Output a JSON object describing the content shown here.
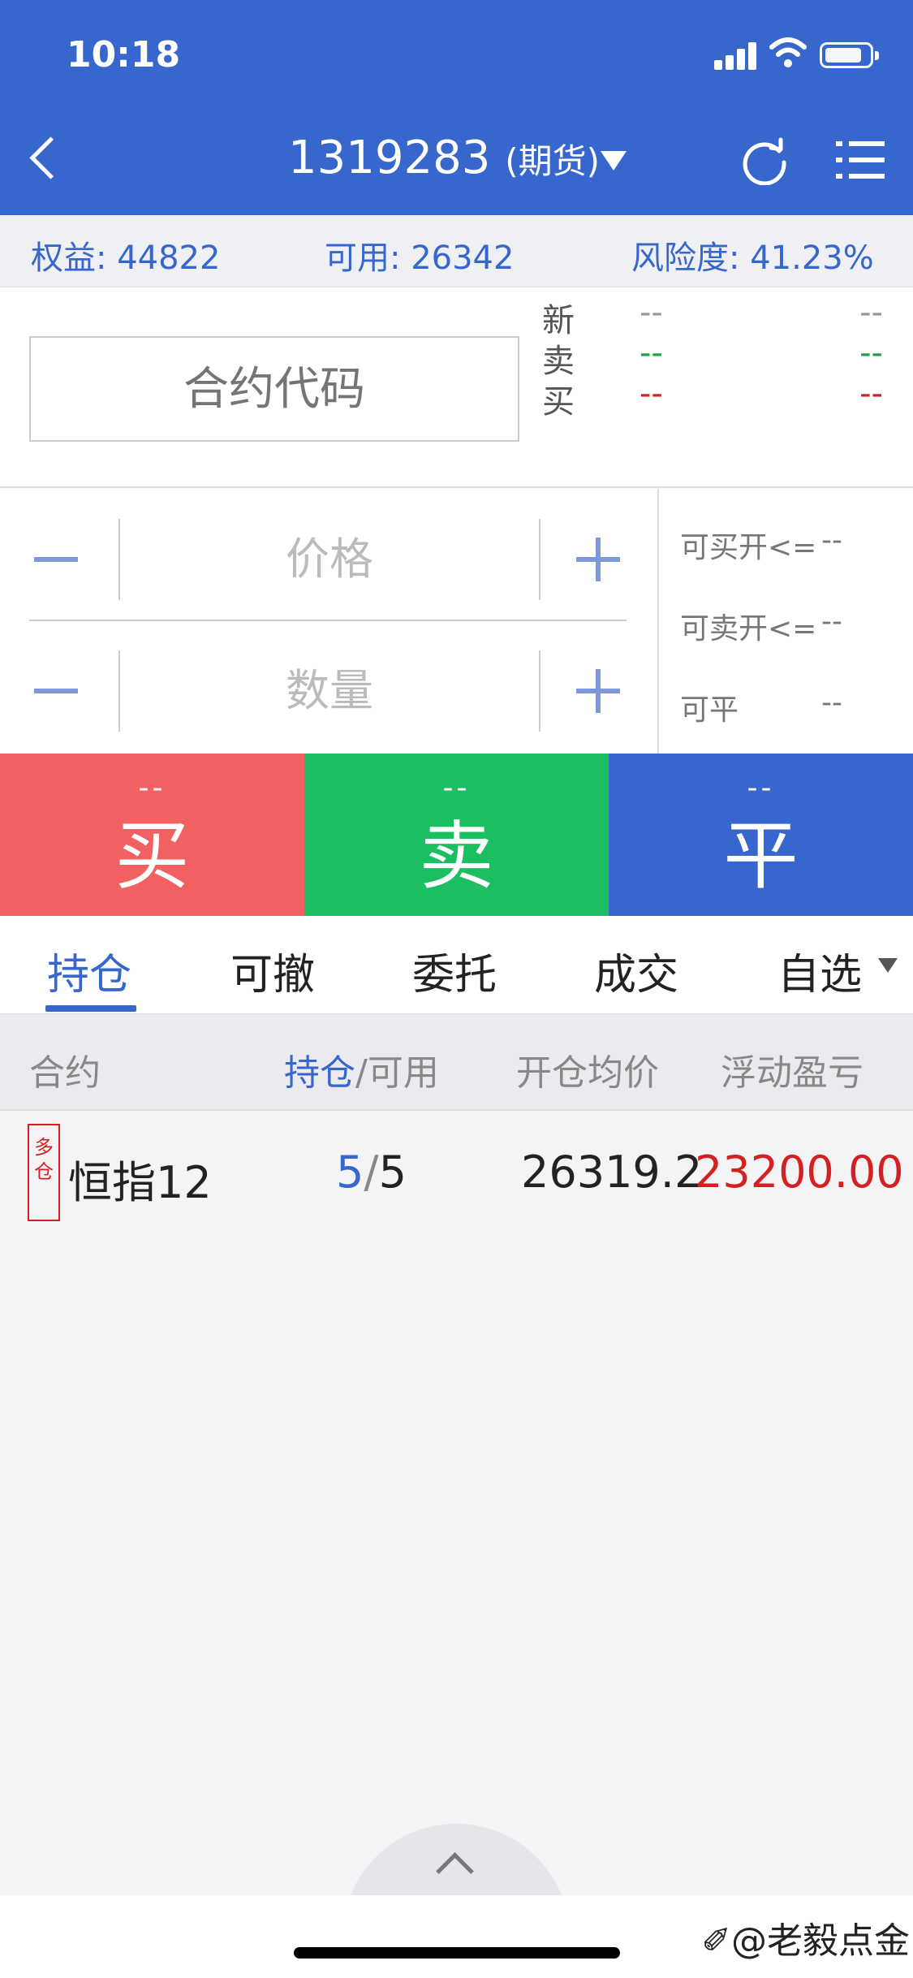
{
  "status_bar": {
    "time": "10:18"
  },
  "header": {
    "account": "1319283",
    "account_type": "(期货)",
    "icons": [
      "back-arrow-icon",
      "chevron-down-icon",
      "refresh-icon",
      "menu-list-icon"
    ]
  },
  "summary": {
    "equity_label": "权益:",
    "equity_value": "44822",
    "available_label": "可用:",
    "available_value": "26342",
    "risk_label": "风险度:",
    "risk_value": "41.23%"
  },
  "quote": {
    "contract_placeholder": "合约代码",
    "rows": [
      {
        "label": "新",
        "v1": "--",
        "v2": "--",
        "color": "#999999"
      },
      {
        "label": "卖",
        "v1": "--",
        "v2": "--",
        "color": "#1aa34a"
      },
      {
        "label": "买",
        "v1": "--",
        "v2": "--",
        "color": "#d42020"
      }
    ]
  },
  "order": {
    "price_placeholder": "价格",
    "quantity_placeholder": "数量",
    "can_buy_open_label": "可买开<=",
    "can_buy_open_value": "--",
    "can_sell_open_label": "可卖开<=",
    "can_sell_open_value": "--",
    "can_close_label": "可平",
    "can_close_value": "--"
  },
  "trade_buttons": [
    {
      "price": "--",
      "action": "买",
      "color": "#f26161"
    },
    {
      "price": "--",
      "action": "卖",
      "color": "#1bbf62"
    },
    {
      "price": "--",
      "action": "平",
      "color": "#3766cc"
    }
  ],
  "tabs": [
    {
      "label": "持仓",
      "active": true
    },
    {
      "label": "可撤",
      "active": false
    },
    {
      "label": "委托",
      "active": false
    },
    {
      "label": "成交",
      "active": false
    },
    {
      "label": "自选",
      "active": false
    }
  ],
  "table": {
    "headers": {
      "contract": "合约",
      "position": "持仓",
      "available": "/可用",
      "avg_open": "开仓均价",
      "pnl": "浮动盈亏"
    },
    "rows": [
      {
        "tag_line1": "多",
        "tag_line2": "仓",
        "contract": "恒指12",
        "position": "5",
        "sep": "/",
        "available": "5",
        "avg_open": "26319.2",
        "pnl": "23200.00"
      }
    ]
  },
  "watermark": "✐@老毅点金",
  "colors": {
    "header_blue": "#3766cc",
    "buy_red": "#f26161",
    "sell_green": "#1bbf62",
    "loss_red": "#d42020"
  }
}
